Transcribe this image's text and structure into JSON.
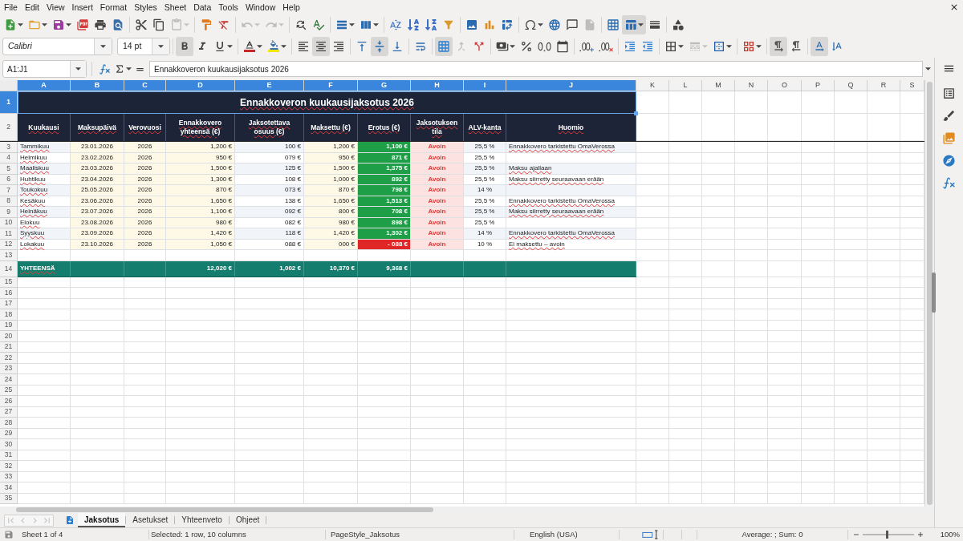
{
  "menu_bar": {
    "items": [
      "File",
      "Edit",
      "View",
      "Insert",
      "Format",
      "Styles",
      "Sheet",
      "Data",
      "Tools",
      "Window",
      "Help"
    ]
  },
  "standard_toolbar": {
    "paste": {
      "disabled": true
    },
    "undo": {
      "disabled": true
    },
    "redo": {
      "disabled": true
    },
    "headers_footers": {
      "disabled": true
    },
    "freeze_rows_columns": {
      "on": true
    }
  },
  "formatting_toolbar": {
    "font_name": "Calibri",
    "font_size": "14 pt",
    "bold": {
      "on": true
    },
    "italic": {
      "on": false
    },
    "underline": {
      "on": false
    },
    "align_left": {
      "on": false
    },
    "align_center": {
      "on": true
    },
    "align_right": {
      "on": false
    },
    "align_top": {
      "on": false
    },
    "align_middle": {
      "on": true
    },
    "align_bottom": {
      "on": false
    },
    "wrap_text": {
      "on": false
    },
    "merge_and_center": {
      "on": true
    },
    "merge_cells": {
      "disabled": true
    },
    "border_style": {
      "disabled": true
    },
    "left_to_right": {
      "on": true
    },
    "right_to_left": {
      "on": false
    },
    "text_horizontal": {
      "on": true
    },
    "text_vertical": {
      "on": false
    }
  },
  "formula_bar": {
    "name_box": "A1:J1",
    "content": "Ennakkoveron kuukausijaksotus 2026"
  },
  "sheet": {
    "auto_spellcheck": true,
    "columns": [
      {
        "label": "A",
        "selected": true
      },
      {
        "label": "B",
        "selected": true
      },
      {
        "label": "C",
        "selected": true
      },
      {
        "label": "D",
        "selected": true
      },
      {
        "label": "E",
        "selected": true
      },
      {
        "label": "F",
        "selected": true
      },
      {
        "label": "G",
        "selected": true
      },
      {
        "label": "H",
        "selected": true
      },
      {
        "label": "I",
        "selected": true
      },
      {
        "label": "J",
        "selected": true
      },
      {
        "label": "K",
        "selected": false
      },
      {
        "label": "L",
        "selected": false
      },
      {
        "label": "M",
        "selected": false
      },
      {
        "label": "N",
        "selected": false
      },
      {
        "label": "O",
        "selected": false
      },
      {
        "label": "P",
        "selected": false
      },
      {
        "label": "Q",
        "selected": false
      },
      {
        "label": "R",
        "selected": false
      },
      {
        "label": "S",
        "selected": false
      }
    ],
    "row_numbers": [
      {
        "label": "1",
        "selected": true
      },
      {
        "label": "2",
        "selected": false
      },
      {
        "label": "3",
        "selected": false
      },
      {
        "label": "4",
        "selected": false
      },
      {
        "label": "5",
        "selected": false
      },
      {
        "label": "6",
        "selected": false
      },
      {
        "label": "7",
        "selected": false
      },
      {
        "label": "8",
        "selected": false
      },
      {
        "label": "9",
        "selected": false
      },
      {
        "label": "10",
        "selected": false
      },
      {
        "label": "11",
        "selected": false
      },
      {
        "label": "12",
        "selected": false
      },
      {
        "label": "13",
        "selected": false
      },
      {
        "label": "14",
        "selected": false
      },
      {
        "label": "15",
        "selected": false
      },
      {
        "label": "16",
        "selected": false
      },
      {
        "label": "17",
        "selected": false
      },
      {
        "label": "18",
        "selected": false
      },
      {
        "label": "19",
        "selected": false
      },
      {
        "label": "20",
        "selected": false
      },
      {
        "label": "21",
        "selected": false
      },
      {
        "label": "22",
        "selected": false
      },
      {
        "label": "23",
        "selected": false
      },
      {
        "label": "24",
        "selected": false
      },
      {
        "label": "25",
        "selected": false
      },
      {
        "label": "26",
        "selected": false
      },
      {
        "label": "27",
        "selected": false
      },
      {
        "label": "28",
        "selected": false
      },
      {
        "label": "29",
        "selected": false
      },
      {
        "label": "30",
        "selected": false
      },
      {
        "label": "31",
        "selected": false
      },
      {
        "label": "32",
        "selected": false
      },
      {
        "label": "33",
        "selected": false
      },
      {
        "label": "34",
        "selected": false
      },
      {
        "label": "35",
        "selected": false
      }
    ],
    "title": {
      "text": "Ennakkoveron kuukausijaksotus 2026",
      "selected": true
    },
    "header": [
      "Kuukausi",
      "Maksupäivä",
      "Verovuosi",
      "Ennakkovero yhteensä (€)",
      "Jaksotettava osuus (€)",
      "Maksettu (€)",
      "Erotus (€)",
      "Jaksotuksen tila",
      "ALV-kanta",
      "Huomio"
    ],
    "rows": [
      {
        "month": "Tammikuu",
        "due_date": "23.01.2026",
        "tax_year": "2026",
        "total_amount": "1,200 €",
        "portion": "100 €",
        "paid": "1,200 €",
        "difference": {
          "text": "1,100 €",
          "color": "#1f9e48"
        },
        "status": "Avoin",
        "vat_rate": "25,5 %",
        "note": "Ennakkovero tarkistettu OmaVerossa"
      },
      {
        "month": "Helmikuu",
        "due_date": "23.02.2026",
        "tax_year": "2026",
        "total_amount": "950 €",
        "portion": "079 €",
        "paid": "950 €",
        "difference": {
          "text": "871 €",
          "color": "#1f9e48"
        },
        "status": "Avoin",
        "vat_rate": "25,5 %"
      },
      {
        "month": "Maaliskuu",
        "due_date": "23.03.2026",
        "tax_year": "2026",
        "total_amount": "1,500 €",
        "portion": "125 €",
        "paid": "1,500 €",
        "difference": {
          "text": "1,375 €",
          "color": "#1f9e48"
        },
        "status": "Avoin",
        "vat_rate": "25,5 %",
        "note": "Maksu ajallaan"
      },
      {
        "month": "Huhtikuu",
        "due_date": "23.04.2026",
        "tax_year": "2026",
        "total_amount": "1,300 €",
        "portion": "108 €",
        "paid": "1,000 €",
        "difference": {
          "text": "892 €",
          "color": "#1f9e48"
        },
        "status": "Avoin",
        "vat_rate": "25,5 %",
        "note": "Maksu siirretty seuraavaan erään"
      },
      {
        "month": "Toukokuu",
        "due_date": "25.05.2026",
        "tax_year": "2026",
        "total_amount": "870 €",
        "portion": "073 €",
        "paid": "870 €",
        "difference": {
          "text": "798 €",
          "color": "#1f9e48"
        },
        "status": "Avoin",
        "vat_rate": "14 %"
      },
      {
        "month": "Kesäkuu",
        "due_date": "23.06.2026",
        "tax_year": "2026",
        "total_amount": "1,650 €",
        "portion": "138 €",
        "paid": "1,650 €",
        "difference": {
          "text": "1,513 €",
          "color": "#1f9e48"
        },
        "status": "Avoin",
        "vat_rate": "25,5 %",
        "note": "Ennakkovero tarkistettu OmaVerossa"
      },
      {
        "month": "Heinäkuu",
        "due_date": "23.07.2026",
        "tax_year": "2026",
        "total_amount": "1,100 €",
        "portion": "092 €",
        "paid": "800 €",
        "difference": {
          "text": "708 €",
          "color": "#1f9e48"
        },
        "status": "Avoin",
        "vat_rate": "25,5 %",
        "note": "Maksu siirretty seuraavaan erään"
      },
      {
        "month": "Elokuu",
        "due_date": "23.08.2026",
        "tax_year": "2026",
        "total_amount": "980 €",
        "portion": "082 €",
        "paid": "980 €",
        "difference": {
          "text": "898 €",
          "color": "#1f9e48"
        },
        "status": "Avoin",
        "vat_rate": "25,5 %"
      },
      {
        "month": "Syyskuu",
        "due_date": "23.09.2026",
        "tax_year": "2026",
        "total_amount": "1,420 €",
        "portion": "118 €",
        "paid": "1,420 €",
        "difference": {
          "text": "1,302 €",
          "color": "#1f9e48"
        },
        "status": "Avoin",
        "vat_rate": "14 %",
        "note": "Ennakkovero tarkistettu OmaVerossa"
      },
      {
        "month": "Lokakuu",
        "due_date": "23.10.2026",
        "tax_year": "2026",
        "total_amount": "1,050 €",
        "portion": "088 €",
        "paid": "000 €",
        "difference": {
          "text": "- 088 €",
          "color": "#e02626"
        },
        "status": "Avoin",
        "vat_rate": "10 %",
        "note": "Ei maksettu – avoin"
      }
    ],
    "total": {
      "label": "YHTEENSÄ",
      "total_amount": "12,020 €",
      "portion": "1,002 €",
      "paid": "10,370 €",
      "difference": "9,368 €"
    }
  },
  "sheet_tabs": [
    {
      "label": "Jaksotus",
      "selected": true
    },
    {
      "label": "Asetukset",
      "selected": false
    },
    {
      "label": "Yhteenveto",
      "selected": false
    },
    {
      "label": "Ohjeet",
      "selected": false
    }
  ],
  "status_bar": {
    "sheet": "Sheet 1 of 4",
    "selection": "Selected: 1 row, 10 columns",
    "page_style": "PageStyle_Jaksotus",
    "language": "English (USA)",
    "summary": "Average: ; Sum: 0",
    "zoom": {
      "level": 0.48
    },
    "zoom_percent": "100%"
  }
}
